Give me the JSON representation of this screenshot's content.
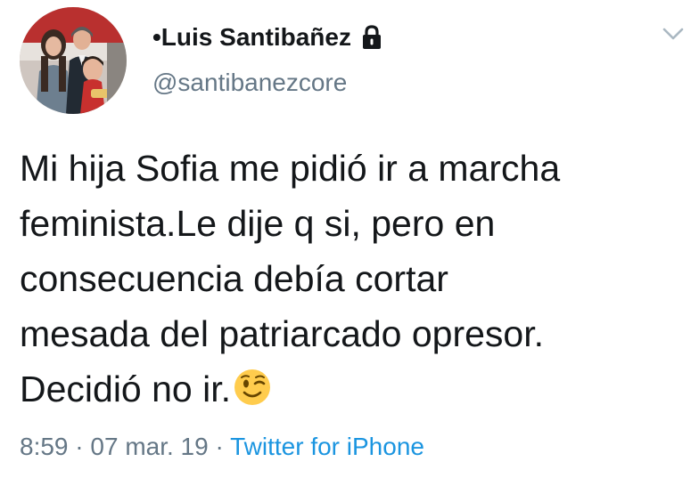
{
  "user": {
    "display_name": "•Luis Santibañez",
    "handle": "@santibanezcore",
    "protected_icon": "lock-icon"
  },
  "menu": {
    "icon": "chevron-down-icon"
  },
  "tweet": {
    "text_before_emoji": "Mi hija Sofia me pidió ir a marcha\nfeminista.Le dije q si, pero en\nconsecuencia debía cortar\nmesada del patriarcado opresor.\nDecidió no ir.",
    "emoji": "winking-face-emoji"
  },
  "meta": {
    "time": "8:59",
    "separator1": " · ",
    "date": "07 mar. 19",
    "separator2": " · ",
    "source": "Twitter for iPhone"
  },
  "colors": {
    "text": "#14171a",
    "secondary": "#657786",
    "link": "#1b95e0"
  }
}
